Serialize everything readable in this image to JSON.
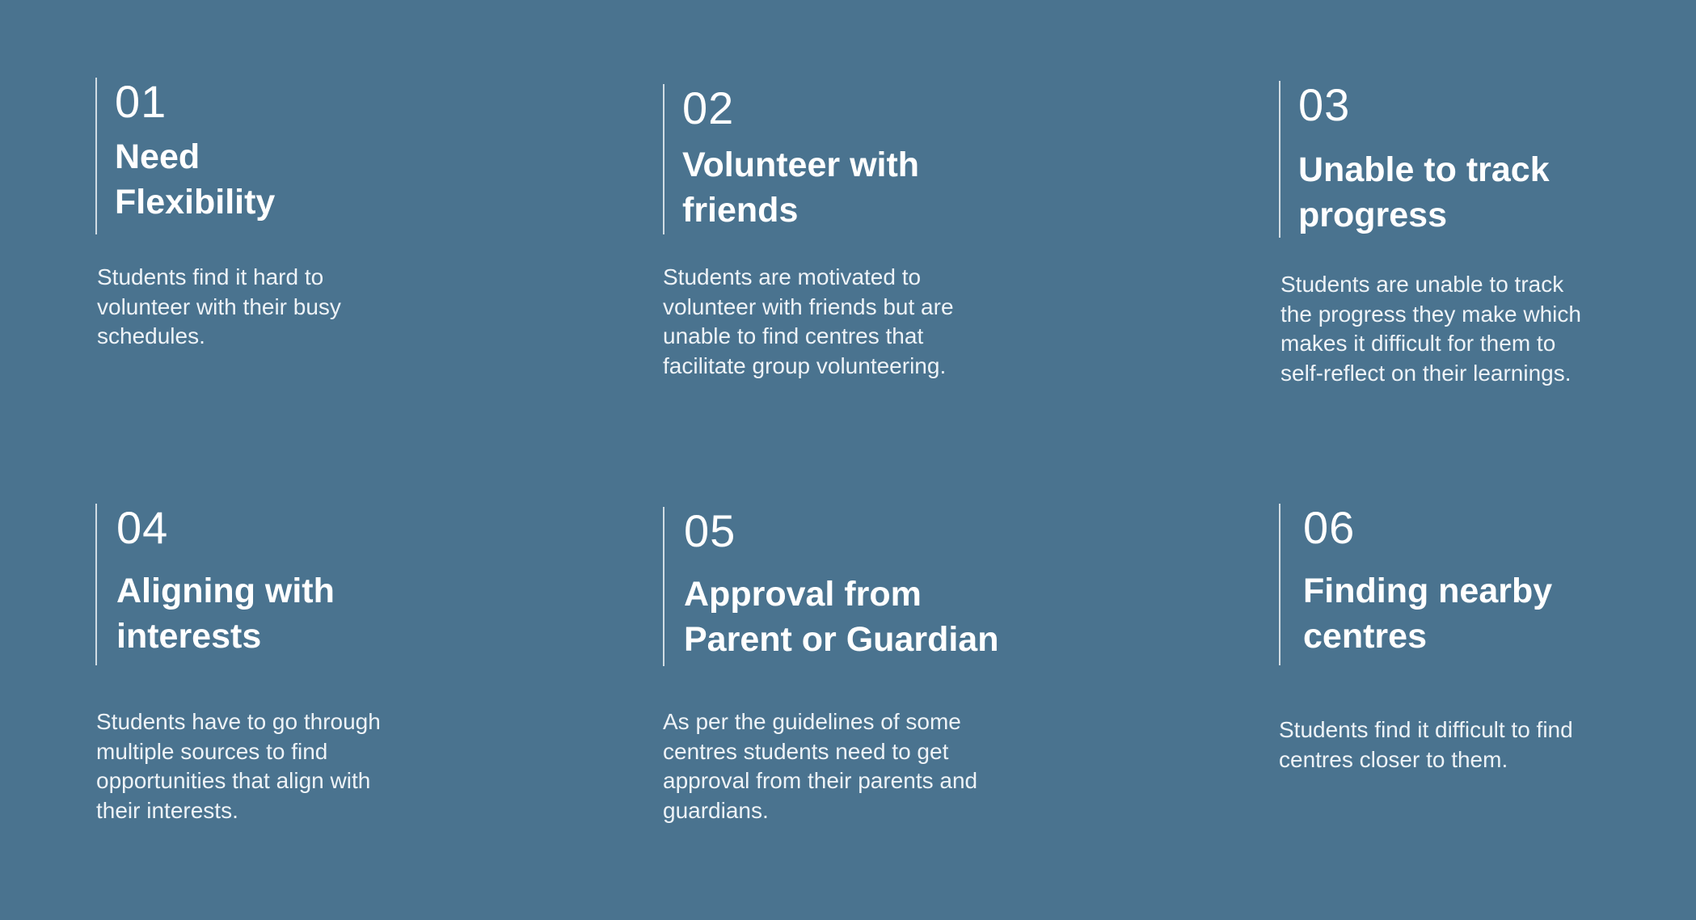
{
  "colors": {
    "background": "#4a738f",
    "text": "#ffffff",
    "divider": "#ffffff"
  },
  "cards": [
    {
      "number": "01",
      "title": "Need\nFlexibility",
      "description": "Students find it hard to\nvolunteer with their busy\nschedules."
    },
    {
      "number": "02",
      "title": "Volunteer with\nfriends",
      "description": "Students are motivated to\nvolunteer with friends but are\nunable to find centres that\nfacilitate group volunteering."
    },
    {
      "number": "03",
      "title": "Unable to track\nprogress",
      "description": "Students are unable to track\nthe progress they make which\nmakes it difficult for them to\nself-reflect on their learnings."
    },
    {
      "number": "04",
      "title": "Aligning with\ninterests",
      "description": "Students have to go through\nmultiple sources to find\nopportunities that align with\ntheir interests."
    },
    {
      "number": "05",
      "title": "Approval from\nParent or Guardian",
      "description": "As per the guidelines of some\ncentres students need to get\napproval from their parents and\nguardians."
    },
    {
      "number": "06",
      "title": "Finding nearby\ncentres",
      "description": "Students find it difficult to find\ncentres closer to them."
    }
  ]
}
